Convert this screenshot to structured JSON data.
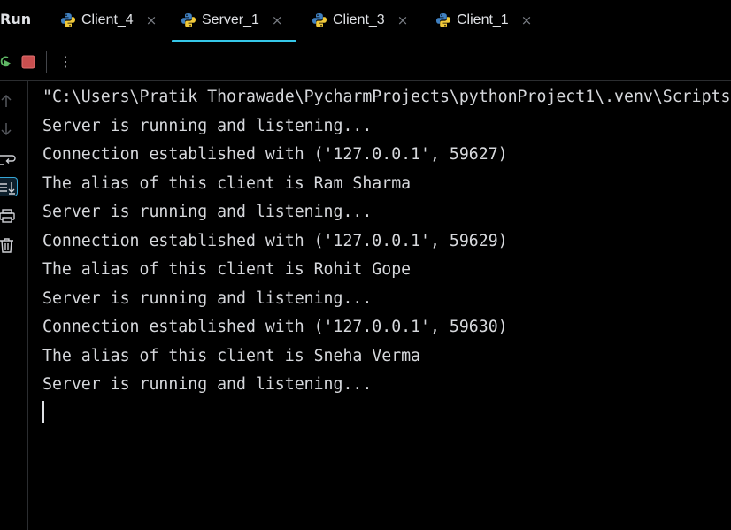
{
  "toolwindow": {
    "title": "Run"
  },
  "tabs": [
    {
      "label": "Client_4",
      "active": false
    },
    {
      "label": "Server_1",
      "active": true
    },
    {
      "label": "Client_3",
      "active": false
    },
    {
      "label": "Client_1",
      "active": false
    }
  ],
  "tab_close_glyph": "×",
  "toolbar": {
    "more_glyph": "⋮"
  },
  "console": {
    "lines": [
      "\"C:\\Users\\Pratik Thorawade\\PycharmProjects\\pythonProject1\\.venv\\Scripts",
      "Server is running and listening...",
      "Connection established with ('127.0.0.1', 59627)",
      "The alias of this client is Ram Sharma",
      "Server is running and listening...",
      "Connection established with ('127.0.0.1', 59629)",
      "The alias of this client is Rohit Gope",
      "Server is running and listening...",
      "Connection established with ('127.0.0.1', 59630)",
      "The alias of this client is Sneha Verma",
      "Server is running and listening..."
    ]
  },
  "icons": {
    "python": "python-file-icon",
    "rerun": "rerun-icon",
    "stop": "stop-icon",
    "up": "arrow-up-icon",
    "down": "arrow-down-icon",
    "wrap": "soft-wrap-icon",
    "scroll": "scroll-to-end-icon",
    "print": "print-icon",
    "trash": "trash-icon"
  },
  "colors": {
    "background": "#000000",
    "text": "#d6d8dc",
    "accent": "#35c7e8",
    "stop": "#c94f4f",
    "rerun": "#5fb865"
  }
}
